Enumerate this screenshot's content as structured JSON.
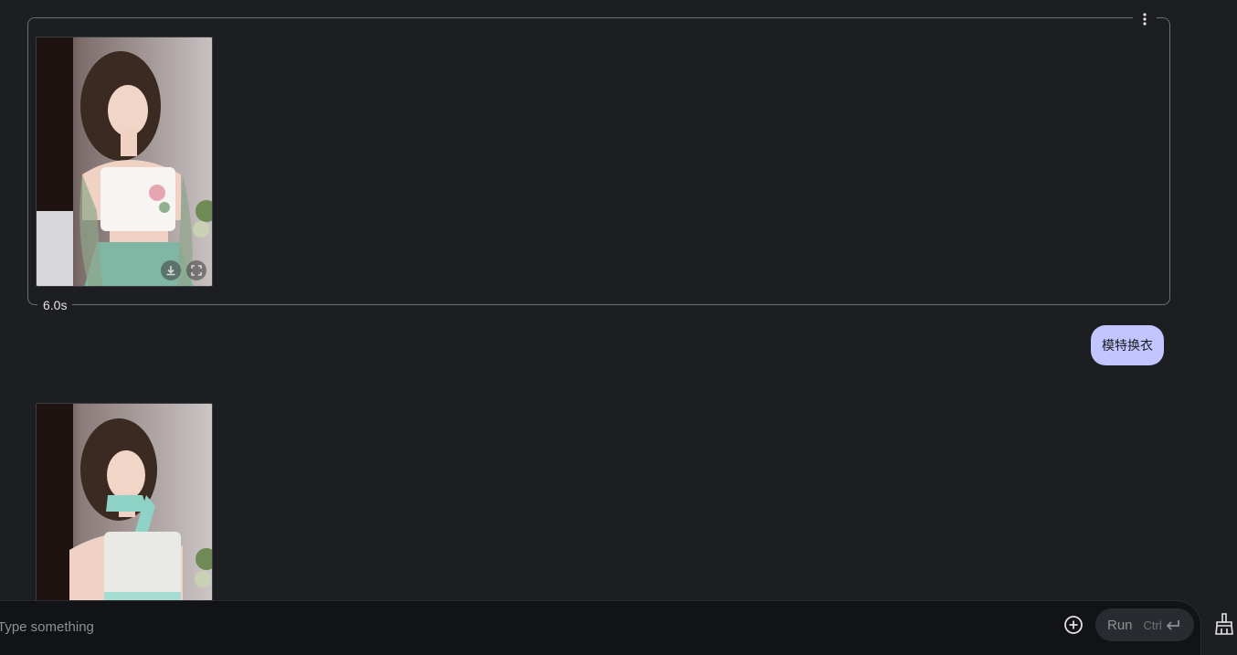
{
  "model_turn": {
    "time": "6.0s",
    "more_icon": "more-vert-icon",
    "image_actions": [
      "download-icon",
      "fullscreen-icon"
    ]
  },
  "user_turn": {
    "text": "模特换衣"
  },
  "composer": {
    "placeholder": "Type something",
    "add_icon": "add-circle-icon",
    "run_label": "Run",
    "run_shortcut": "Ctrl",
    "enter_icon": "keyboard-return-icon",
    "clear_icon": "broom-icon"
  },
  "colors": {
    "background": "#1d1e21",
    "user_bubble": "#c2c5ff",
    "composer": "#121317"
  }
}
